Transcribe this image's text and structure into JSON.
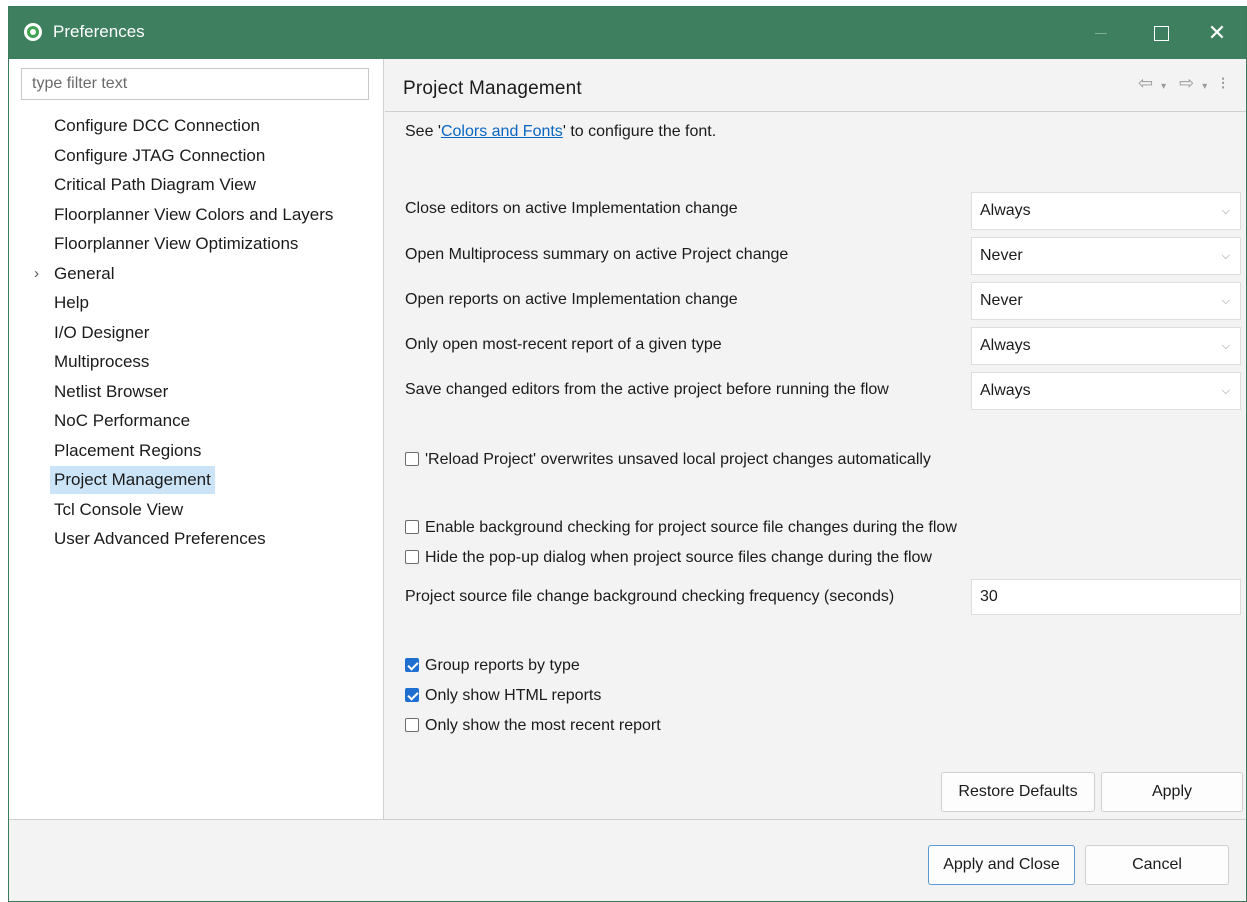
{
  "window": {
    "title": "Preferences",
    "close_glyph": "✕"
  },
  "filter": {
    "placeholder": "type filter text"
  },
  "tree": {
    "items": [
      {
        "label": "Configure DCC Connection"
      },
      {
        "label": "Configure JTAG Connection"
      },
      {
        "label": "Critical Path Diagram View"
      },
      {
        "label": "Floorplanner View Colors and Layers"
      },
      {
        "label": "Floorplanner View Optimizations"
      },
      {
        "label": "General",
        "expander": "›"
      },
      {
        "label": "Help"
      },
      {
        "label": "I/O Designer"
      },
      {
        "label": "Multiprocess"
      },
      {
        "label": "Netlist Browser"
      },
      {
        "label": "NoC Performance"
      },
      {
        "label": "Placement Regions"
      },
      {
        "label": "Project Management",
        "selected": true
      },
      {
        "label": "Tcl Console View"
      },
      {
        "label": "User Advanced Preferences"
      }
    ]
  },
  "page": {
    "title": "Project Management",
    "nav_icons": {
      "back": "⇦",
      "forward": "⇨",
      "dropdown": "▾",
      "menu": "⁝"
    },
    "font_prefix": "See '",
    "font_link": "Colors and Fonts",
    "font_suffix": "' to configure the font.",
    "combos": [
      {
        "label": "Close editors on active Implementation change",
        "value": "Always"
      },
      {
        "label": "Open Multiprocess summary on active Project change",
        "value": "Never"
      },
      {
        "label": "Open reports on active Implementation change",
        "value": "Never"
      },
      {
        "label": "Only open most-recent report of a given type",
        "value": "Always"
      },
      {
        "label": "Save changed editors from the active project before running the flow",
        "value": "Always"
      }
    ],
    "combo_chevron": "⌵",
    "reload_check": {
      "label": "'Reload Project' overwrites unsaved local project changes automatically",
      "checked": false
    },
    "bg_check": {
      "label": "Enable background checking for project source file changes during the flow",
      "checked": false
    },
    "hide_popup_check": {
      "label": "Hide the pop-up dialog when project source files change during the flow",
      "checked": false
    },
    "frequency": {
      "label": "Project source file change background checking frequency (seconds)",
      "value": "30"
    },
    "group_reports": {
      "label": "Group reports by type",
      "checked": true
    },
    "html_reports": {
      "label": "Only show HTML reports",
      "checked": true
    },
    "recent_report": {
      "label": "Only show the most recent report",
      "checked": false
    },
    "restore_defaults": "Restore Defaults",
    "apply": "Apply"
  },
  "footer": {
    "apply_and_close": "Apply and Close",
    "cancel": "Cancel"
  },
  "colors": {
    "titlebar": "#3d7f5e",
    "selection": "#cce4f7",
    "link": "#0b66c2",
    "checkbox_on": "#1f6fd1"
  }
}
